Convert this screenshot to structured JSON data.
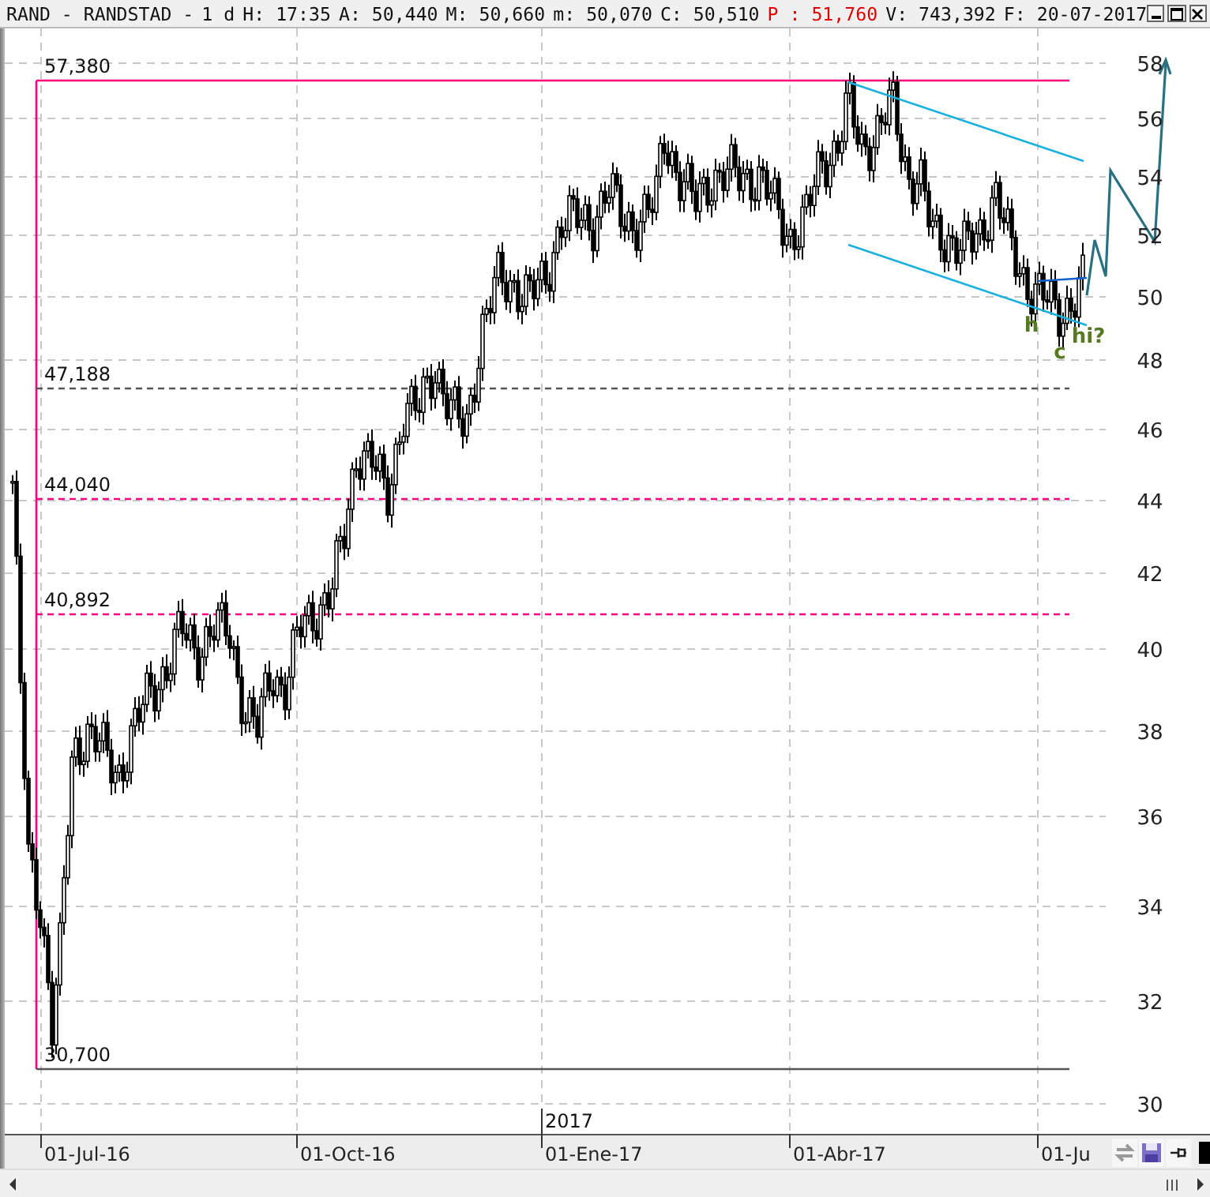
{
  "title_bar": {
    "symbol": "RAND - RANDSTAD -",
    "period": "1 d",
    "fields": [
      {
        "label": "H:",
        "value": "17:35",
        "highlight": false
      },
      {
        "label": "A:",
        "value": "50,440",
        "highlight": false
      },
      {
        "label": "M:",
        "value": "50,660",
        "highlight": false
      },
      {
        "label": "m:",
        "value": "50,070",
        "highlight": false
      },
      {
        "label": "C:",
        "value": "50,510",
        "highlight": false
      },
      {
        "label": "P :",
        "value": "51,760",
        "highlight": true
      },
      {
        "label": "V:",
        "value": "743,392",
        "highlight": false
      },
      {
        "label": "F:",
        "value": "20-07-2017",
        "highlight": false
      }
    ]
  },
  "chart": {
    "y_axis_labels": [
      "58",
      "56",
      "54",
      "52",
      "50",
      "48",
      "46",
      "44",
      "42",
      "40",
      "38",
      "36",
      "34",
      "32",
      "30"
    ],
    "x_axis_labels": [
      "01-Jul-16",
      "01-Oct-16",
      "01-Ene-17",
      "01-Abr-17",
      "01-Ju"
    ],
    "year_label": "2017",
    "level_labels": [
      "57,380",
      "47,188",
      "44,040",
      "40,892",
      "30,700"
    ],
    "wave_labels": [
      "h",
      "c",
      "hi?"
    ]
  }
}
